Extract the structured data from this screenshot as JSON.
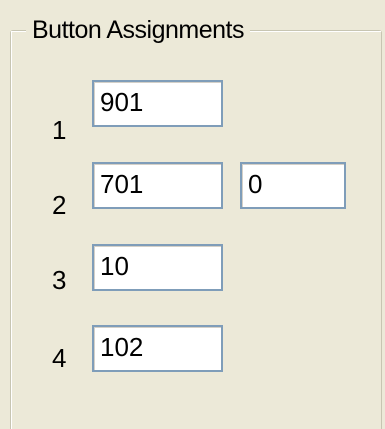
{
  "group": {
    "title": "Button Assignments"
  },
  "rows": [
    {
      "label": "1",
      "value": "901"
    },
    {
      "label": "2",
      "value": "701",
      "extra_value": "0"
    },
    {
      "label": "3",
      "value": "10"
    },
    {
      "label": "4",
      "value": "102"
    }
  ]
}
